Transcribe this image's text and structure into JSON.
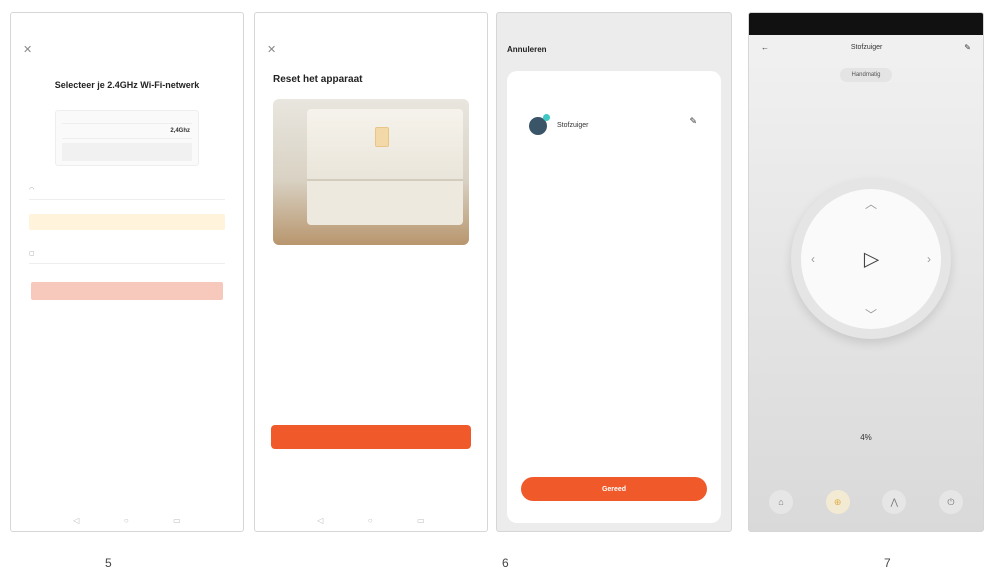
{
  "phones": [
    {
      "status": {
        "time": "",
        "icons": ""
      },
      "title": "Selecteer je 2.4GHz Wi-Fi-netwerk",
      "subtitle": "",
      "link": "",
      "wifi_rows": [
        {
          "label": "",
          "value": ""
        },
        {
          "label": "",
          "value": "2,4Ghz"
        }
      ],
      "fields": [
        "",
        ""
      ],
      "warning": ""
    },
    {
      "status": {
        "time": "",
        "icons": ""
      },
      "title": "Reset het apparaat",
      "instruction": "",
      "confirm_button": "",
      "link": ""
    },
    {
      "status": {
        "time": "",
        "icons": ""
      },
      "header": "Annuleren",
      "device_name": "Stofzuiger",
      "device_sub": "",
      "done_button": "Gereed"
    },
    {
      "status": {
        "time": "",
        "icons": ""
      },
      "title": "Stofzuiger",
      "pill": "Handmatig",
      "battery": "4%",
      "battery_label": "",
      "actions": [
        {
          "icon": "home-icon",
          "label": ""
        },
        {
          "icon": "spot-icon",
          "label": ""
        },
        {
          "icon": "edge-icon",
          "label": ""
        },
        {
          "icon": "power-icon",
          "label": ""
        }
      ]
    }
  ],
  "steps": [
    "5",
    "6",
    "7"
  ],
  "colors": {
    "accent": "#f05a2b",
    "link": "#4a8fe0",
    "warning_bg": "#fff3dc"
  }
}
